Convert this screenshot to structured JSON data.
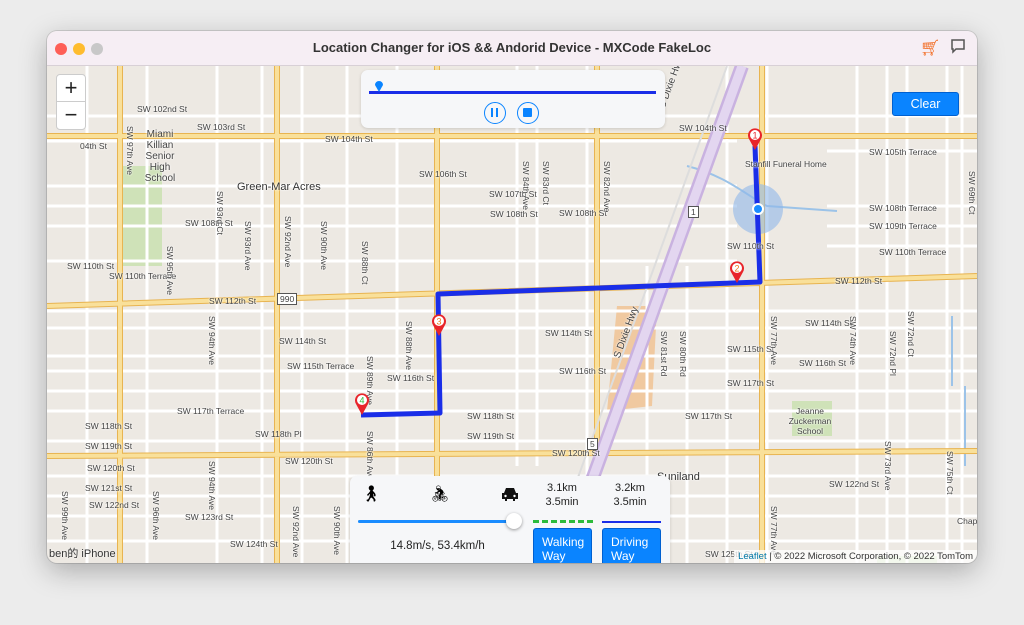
{
  "window": {
    "title": "Location Changer for iOS && Andorid Device - MXCode FakeLoc",
    "cart_icon": "cart-icon",
    "feedback_icon": "speech-bubble-icon"
  },
  "colors": {
    "accent": "#0a84ff",
    "route": "#1a2ee8",
    "walking_line": "#2dbb3c",
    "major_road": "#f6d27a",
    "highway": "#d7c6e8",
    "map_bg": "#ede9e3"
  },
  "zoom": {
    "in": "+",
    "out": "−"
  },
  "playback": {
    "progress": 0.0,
    "pause_icon": "pause-icon",
    "stop_icon": "stop-icon"
  },
  "clear_label": "Clear",
  "speed_panel": {
    "walk_icon": "walking-icon",
    "bike_icon": "bicycle-icon",
    "car_icon": "car-icon",
    "speed_level": 1.0,
    "speed_text": "14.8m/s, 53.4km/h",
    "walking": {
      "distance": "3.1km",
      "time": "3.5min",
      "button": [
        "Walking",
        "Way"
      ]
    },
    "driving": {
      "distance": "3.2km",
      "time": "3.5min",
      "button": [
        "Driving",
        "Way"
      ]
    }
  },
  "markers": [
    "1",
    "2",
    "3",
    "4"
  ],
  "device_name": "ben的 iPhone",
  "attribution": {
    "leaflet": "Leaflet",
    "rest": " | © 2022 Microsoft Corporation, © 2022 TomTom"
  },
  "map": {
    "labels": [
      "SW 102nd St",
      "SW 103rd St",
      "04th St",
      "SW 104th St",
      "SW 103rd St",
      "SW 104th St",
      "Green-Mar Acres",
      "SW 106th St",
      "SW 107th St",
      "SW 108th St",
      "SW 108th St",
      "SW 108th St",
      "SW 105th Terrace",
      "Stanfill Funeral Home",
      "SW 108th Terrace",
      "SW 109th Terrace",
      "SW 110th Terrace",
      "SW 110th St",
      "SW 110th St",
      "SW 110th Terrace",
      "SW 112th St",
      "SW 112th St",
      "SW 114th St",
      "SW 114th St",
      "SW 114th St",
      "SW 115th Terrace",
      "SW 115th St",
      "SW 116th St",
      "SW 116th St",
      "SW 116th St",
      "SW 117th St",
      "SW 117th Terrace",
      "SW 118th St",
      "SW 117th St",
      "SW 118th St",
      "SW 118th Pl",
      "SW 119th St",
      "SW 119th St",
      "SW 120th St",
      "SW 120th St",
      "SW 120th St",
      "SW 121st St",
      "SW 122nd St",
      "SW 123rd St",
      "SW 124th St",
      "Suniland",
      "SW 122nd St",
      "SW 125th St",
      "SW 126th Terrace",
      "Palmetto",
      "Chap"
    ],
    "school_labels": [
      "Miami Killian Senior High School",
      "Jeanne Zuckerman School"
    ],
    "vlabels": [
      "SW 97th Ave",
      "SW 95th Ave",
      "SW 93rd Ct",
      "SW 93rd Ave",
      "SW 92nd Ave",
      "SW 90th Ave",
      "SW 88th Ct",
      "SW 84th Ave",
      "SW 83rd Ct",
      "SW 82nd Ave",
      "SW 77th Ave",
      "SW 81st Rd",
      "SW 80th Rd",
      "SW 74th Ave",
      "SW 72nd Ct",
      "SW 72nd Pl",
      "SW 88th Ave",
      "SW 89th Ave",
      "SW 86th Ave",
      "SW 94th Ave",
      "SW 94th Ave",
      "SW 92nd Ave",
      "SW 90th Ave",
      "SW 96th Ave",
      "SW 99th Ave",
      "SW 73rd Ave",
      "SW 75th Ct",
      "SW 69th Ct",
      "SW 77th Ave"
    ],
    "highway_labels": [
      "S Dixie Hwy",
      "S Dixie Hwy"
    ],
    "shields": [
      "990",
      "1",
      "5"
    ]
  }
}
